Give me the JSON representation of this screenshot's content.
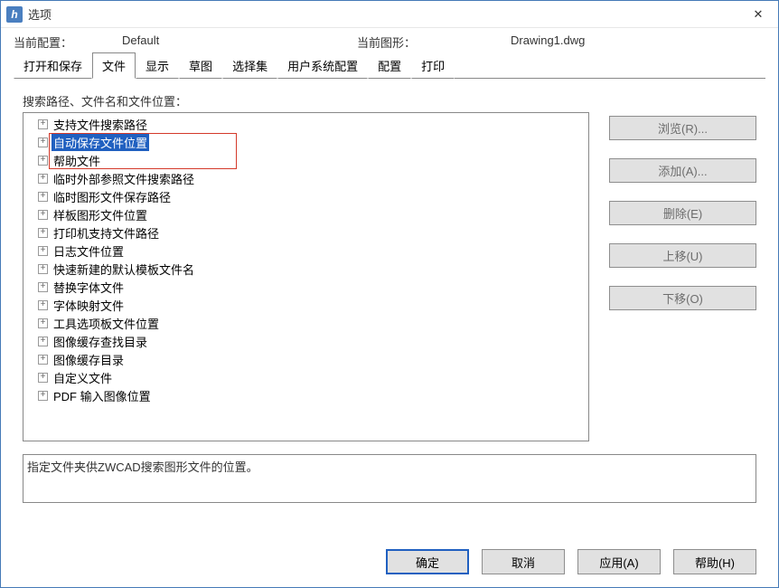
{
  "window": {
    "title": "选项"
  },
  "info": {
    "profile_label": "当前配置：",
    "profile_value": "Default",
    "drawing_label": "当前图形：",
    "drawing_value": "Drawing1.dwg"
  },
  "tabs": [
    {
      "label": "打开和保存"
    },
    {
      "label": "文件"
    },
    {
      "label": "显示"
    },
    {
      "label": "草图"
    },
    {
      "label": "选择集"
    },
    {
      "label": "用户系统配置"
    },
    {
      "label": "配置"
    },
    {
      "label": "打印"
    }
  ],
  "active_tab_index": 1,
  "section_label": "搜索路径、文件名和文件位置：",
  "tree": [
    {
      "label": "支持文件搜索路径"
    },
    {
      "label": "自动保存文件位置"
    },
    {
      "label": "帮助文件"
    },
    {
      "label": "临时外部参照文件搜索路径"
    },
    {
      "label": "临时图形文件保存路径"
    },
    {
      "label": "样板图形文件位置"
    },
    {
      "label": "打印机支持文件路径"
    },
    {
      "label": "日志文件位置"
    },
    {
      "label": "快速新建的默认模板文件名"
    },
    {
      "label": "替换字体文件"
    },
    {
      "label": "字体映射文件"
    },
    {
      "label": "工具选项板文件位置"
    },
    {
      "label": "图像缓存查找目录"
    },
    {
      "label": "图像缓存目录"
    },
    {
      "label": "自定义文件"
    },
    {
      "label": "PDF 输入图像位置"
    }
  ],
  "selected_tree_index": 1,
  "side_buttons": {
    "browse": "浏览(R)...",
    "add": "添加(A)...",
    "remove": "删除(E)",
    "moveup": "上移(U)",
    "movedown": "下移(O)"
  },
  "description": "指定文件夹供ZWCAD搜索图形文件的位置。",
  "footer": {
    "ok": "确定",
    "cancel": "取消",
    "apply": "应用(A)",
    "help": "帮助(H)"
  }
}
